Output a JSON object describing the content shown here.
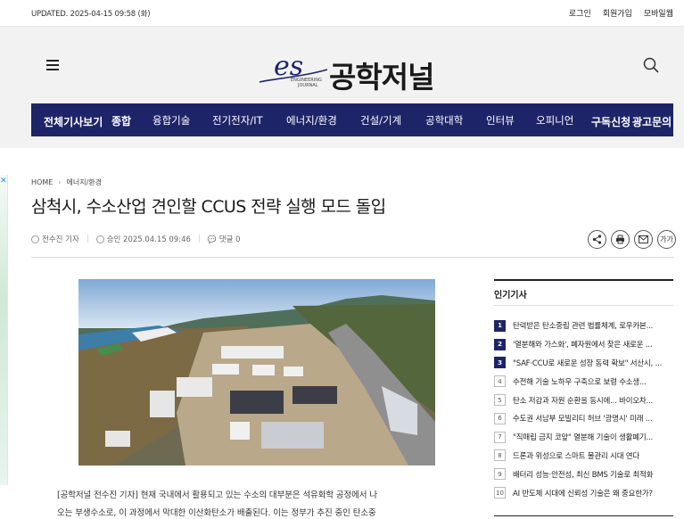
{
  "topbar": {
    "updated": "UPDATED. 2025-04-15 09:58 (화)",
    "links": [
      "로그인",
      "회원가입",
      "모바일웹"
    ]
  },
  "logo": {
    "mark_text": "es",
    "sub_text_1": "ENGINEERING",
    "sub_text_2": "JOURNAL",
    "title": "공학저널"
  },
  "nav": {
    "all_articles": "전체기사보기",
    "items": [
      "종합",
      "융합기술",
      "전기전자/IT",
      "에너지/환경",
      "건설/기계",
      "공학대학",
      "인터뷰",
      "오피니언"
    ],
    "subscribe": "구독신청",
    "ad_inquiry": "광고문의"
  },
  "breadcrumb": {
    "home": "HOME",
    "section": "에너지/환경"
  },
  "article": {
    "title": "삼척시, 수소산업 견인할 CCUS 전략 실행 모드 돌입",
    "reporter": "전수진 기자",
    "approved": "승인 2025.04.15 09:46",
    "comments": "댓글 0",
    "font_size_label": "가가",
    "body_line_1": "[공학저널 전수진 기자] 현재 국내에서 활용되고 있는 수소의 대부분은 석유화학 공정에서 나",
    "body_line_2": "오는 부생수소로, 이 과정에서 막대한 이산화탄소가 배출된다. 이는 정부가 추진 중인 탄소중"
  },
  "popular": {
    "heading": "인기기사",
    "items": [
      {
        "rank": "1",
        "text": "탄력받은 탄소중립 관련 법률체계, 로우카본..."
      },
      {
        "rank": "2",
        "text": "'열분해와 가스화', 폐자원에서 찾은 새로운 ..."
      },
      {
        "rank": "3",
        "text": "\"SAF·CCU로 새로운 성장 동력 확보\" 서산시, ..."
      },
      {
        "rank": "4",
        "text": "수전해 기술 노하우 구축으로 보령 수소생..."
      },
      {
        "rank": "5",
        "text": "탄소 저감과 자원 순환을 동시에... 바이오차..."
      },
      {
        "rank": "6",
        "text": "수도권 서남부 모빌리티 허브 '광명시' 미래 ..."
      },
      {
        "rank": "7",
        "text": "\"직매립 금지 코앞\" 열분해 기술이 생활폐기..."
      },
      {
        "rank": "8",
        "text": "드론과 위성으로 스마트 물관리 시대 연다"
      },
      {
        "rank": "9",
        "text": "배터리 성능·안전성, 최신 BMS 기술로 최적화"
      },
      {
        "rank": "10",
        "text": "AI 반도체 시대에 신뢰성 기술은 왜 중요한가?"
      }
    ]
  },
  "colors": {
    "nav_bg": "#1e2468",
    "header_bg": "#f2f2f2",
    "rank_top_bg": "#1e2468"
  }
}
